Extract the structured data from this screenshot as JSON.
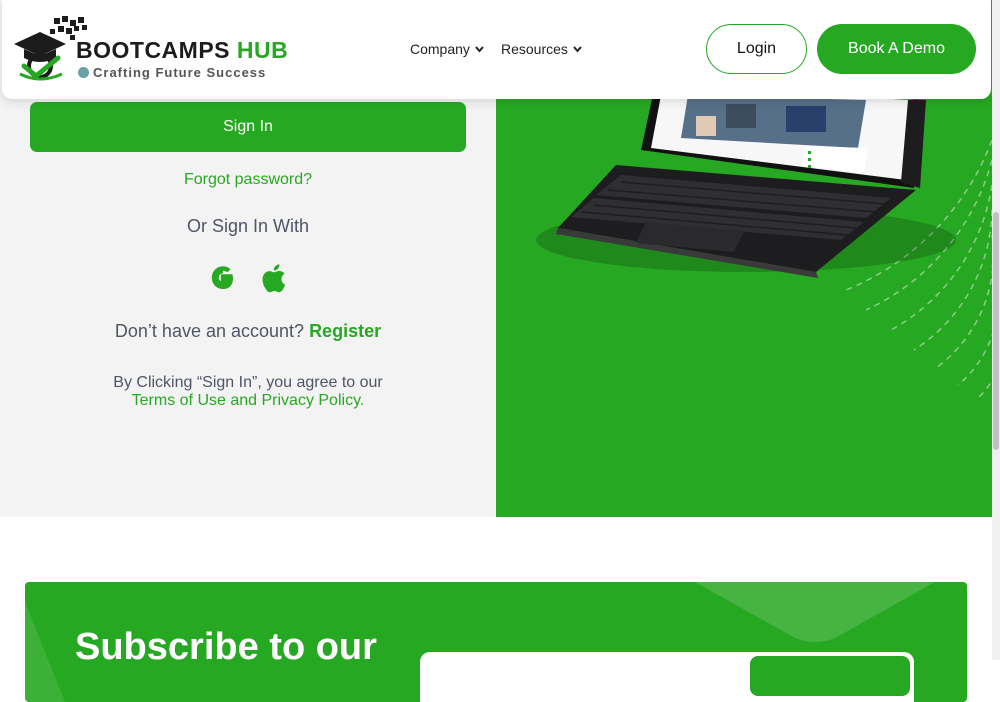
{
  "header": {
    "brand_main": "BOOTCAMPS",
    "brand_accent": "HUB",
    "tagline": "Crafting Future Success",
    "nav": [
      {
        "label": "Company"
      },
      {
        "label": "Resources"
      }
    ],
    "login_label": "Login",
    "demo_label": "Book A Demo"
  },
  "signin": {
    "button_label": "Sign In",
    "forgot_label": "Forgot password?",
    "or_label": "Or Sign In With",
    "social": [
      "google-icon",
      "apple-icon"
    ],
    "no_account_text": "Don’t have an account?",
    "register_label": "Register",
    "agree_text": "By Clicking “Sign In”, you agree to our",
    "terms_label": "Terms of Use and Privacy Policy",
    "terms_suffix": "."
  },
  "newsletter": {
    "title": "Subscribe to our"
  },
  "colors": {
    "brand_green": "#27a822",
    "panel_gray": "#f3f3f3",
    "text_gray": "#4f5566"
  }
}
